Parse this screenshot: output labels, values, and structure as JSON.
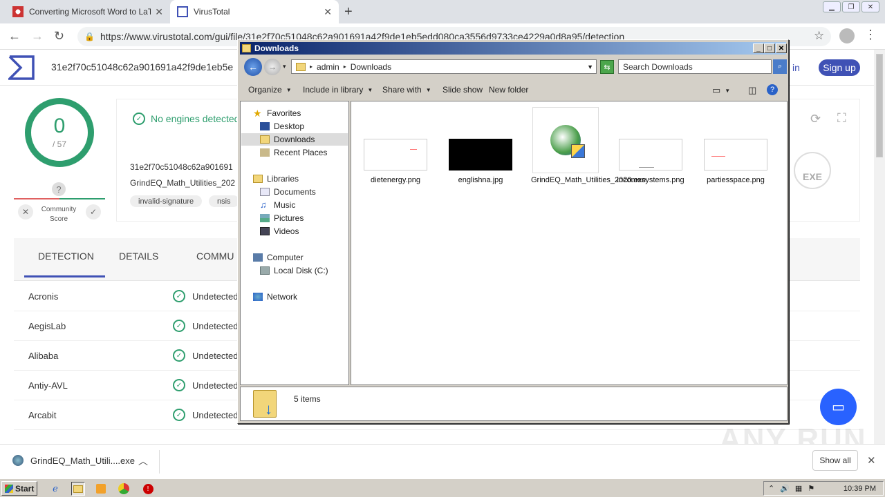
{
  "browser": {
    "tabs": [
      {
        "label": "Converting Microsoft Word to LaTeX",
        "active": false
      },
      {
        "label": "VirusTotal",
        "active": true
      }
    ],
    "url": "https://www.virustotal.com/gui/file/31e2f70c51048c62a901691a42f9de1eb5edd080ca3556d9733ce4229a0d8a95/detection"
  },
  "virustotal": {
    "hash_header": "31e2f70c51048c62a901691a42f9de1eb5e",
    "signin": "in",
    "signup": "Sign up",
    "score": {
      "detected": "0",
      "total": "/ 57"
    },
    "community_score_label": "Community Score",
    "no_engines": "No engines detected",
    "hash_short": "31e2f70c51048c62a901691",
    "filename_short": "GrindEQ_Math_Utilities_202",
    "tags": [
      "invalid-signature",
      "nsis"
    ],
    "exe_label": "EXE",
    "tabs": [
      "DETECTION",
      "DETAILS",
      "COMMU"
    ],
    "engines": [
      {
        "name": "Acronis",
        "status": "Undetected"
      },
      {
        "name": "AegisLab",
        "status": "Undetected"
      },
      {
        "name": "Alibaba",
        "status": "Undetected"
      },
      {
        "name": "Antiy-AVL",
        "status": "Undetected"
      },
      {
        "name": "Arcabit",
        "status": "Undetected"
      }
    ]
  },
  "download_shelf": {
    "item": "GrindEQ_Math_Utili....exe",
    "show_all": "Show all"
  },
  "explorer": {
    "title": "Downloads",
    "breadcrumb": [
      "admin",
      "Downloads"
    ],
    "search_placeholder": "Search Downloads",
    "toolbar": {
      "organize": "Organize",
      "include_in_library": "Include in library",
      "share_with": "Share with",
      "slide_show": "Slide show",
      "new_folder": "New folder"
    },
    "nav": {
      "favorites": "Favorites",
      "desktop": "Desktop",
      "downloads": "Downloads",
      "recent_places": "Recent Places",
      "libraries": "Libraries",
      "documents": "Documents",
      "music": "Music",
      "pictures": "Pictures",
      "videos": "Videos",
      "computer": "Computer",
      "local_disk": "Local Disk (C:)",
      "network": "Network"
    },
    "files": [
      {
        "name": "dietenergy.png"
      },
      {
        "name": "englishna.jpg"
      },
      {
        "name": "GrindEQ_Math_Utilities_2020.exe"
      },
      {
        "name": "incomesystems.png"
      },
      {
        "name": "partiesspace.png"
      }
    ],
    "item_count": "5 items"
  },
  "taskbar": {
    "start": "Start",
    "clock": "10:39 PM"
  },
  "watermark": "ANY RUN"
}
